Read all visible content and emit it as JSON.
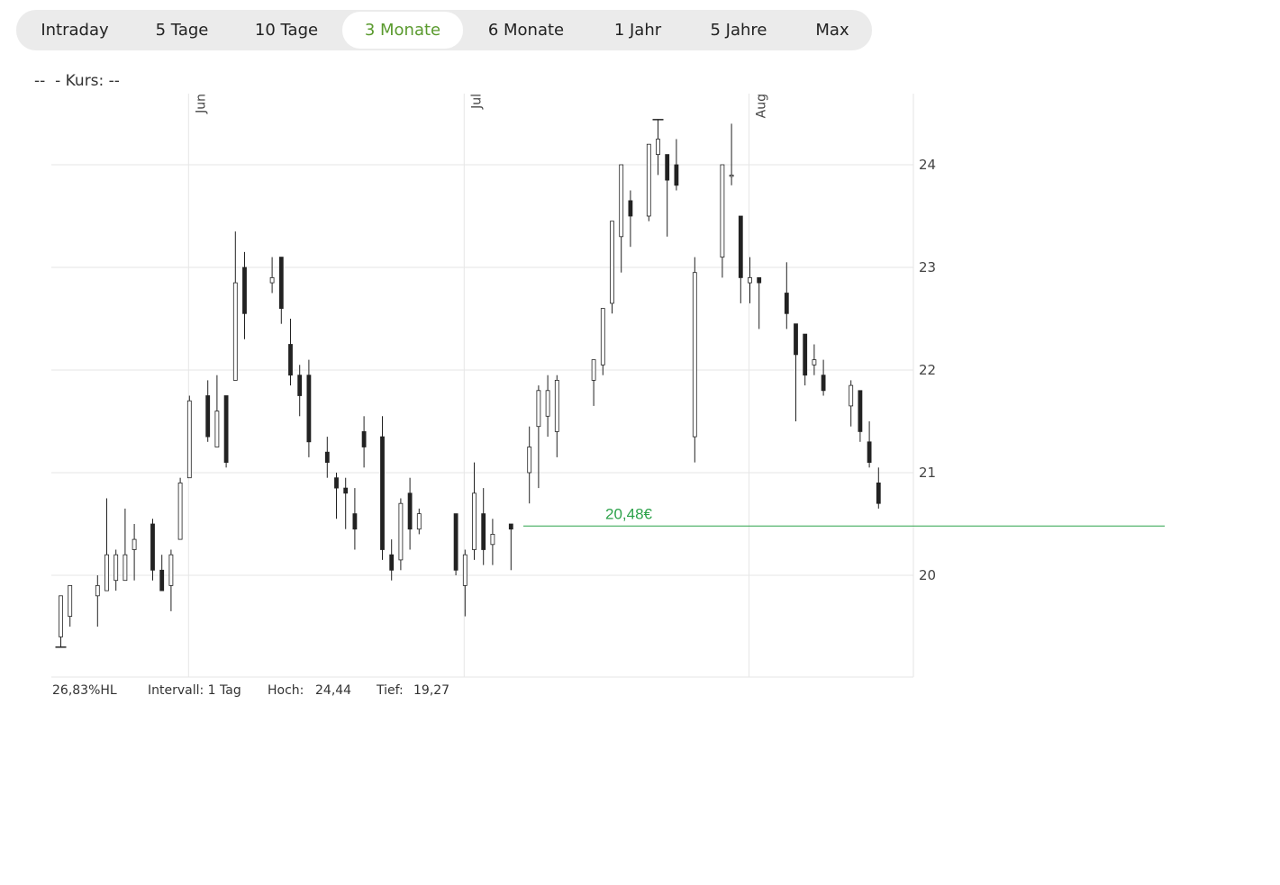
{
  "tabs": [
    {
      "label": "Intraday",
      "active": false
    },
    {
      "label": "5 Tage",
      "active": false
    },
    {
      "label": "10 Tage",
      "active": false
    },
    {
      "label": "3 Monate",
      "active": true
    },
    {
      "label": "6 Monate",
      "active": false
    },
    {
      "label": "1 Jahr",
      "active": false
    },
    {
      "label": "5 Jahre",
      "active": false
    },
    {
      "label": "Max",
      "active": false
    }
  ],
  "info_label": "--  - Kurs: --",
  "footer": {
    "hl": "26,83%HL",
    "interval": "Intervall: 1 Tag",
    "high_label": "Hoch:",
    "high_value": "24,44",
    "low_label": "Tief:",
    "low_value": "19,27"
  },
  "colors": {
    "accent": "#5a9a2e",
    "price_line": "#2ca24a",
    "candle": "#222222",
    "grid": "#e6e6e6"
  },
  "chart_data": {
    "type": "candlestick",
    "y_ticks": [
      20,
      21,
      22,
      23,
      24
    ],
    "ylim": [
      19.0,
      24.7
    ],
    "month_labels": [
      {
        "label": "Jun",
        "index": 14
      },
      {
        "label": "Jul",
        "index": 44
      },
      {
        "label": "Aug",
        "index": 75
      }
    ],
    "current_price": {
      "value": 20.48,
      "label": "20,48€"
    },
    "candles": [
      {
        "o": 19.4,
        "h": 19.8,
        "l": 19.3,
        "c": 19.8
      },
      {
        "o": 19.6,
        "h": 19.85,
        "l": 19.5,
        "c": 19.9
      },
      null,
      null,
      {
        "o": 19.8,
        "h": 20.0,
        "l": 19.5,
        "c": 19.9
      },
      {
        "o": 19.85,
        "h": 20.75,
        "l": 19.85,
        "c": 20.2
      },
      {
        "o": 19.95,
        "h": 20.25,
        "l": 19.85,
        "c": 20.2
      },
      {
        "o": 19.95,
        "h": 20.65,
        "l": 19.95,
        "c": 20.2
      },
      {
        "o": 20.25,
        "h": 20.5,
        "l": 19.95,
        "c": 20.35
      },
      null,
      {
        "o": 20.5,
        "h": 20.55,
        "l": 19.95,
        "c": 20.05
      },
      {
        "o": 20.05,
        "h": 20.2,
        "l": 19.85,
        "c": 19.85
      },
      {
        "o": 19.9,
        "h": 20.25,
        "l": 19.65,
        "c": 20.2
      },
      {
        "o": 20.35,
        "h": 20.95,
        "l": 20.35,
        "c": 20.9
      },
      {
        "o": 20.95,
        "h": 21.75,
        "l": 20.95,
        "c": 21.7
      },
      null,
      {
        "o": 21.75,
        "h": 21.9,
        "l": 21.3,
        "c": 21.35
      },
      {
        "o": 21.25,
        "h": 21.95,
        "l": 21.25,
        "c": 21.6
      },
      {
        "o": 21.75,
        "h": 21.75,
        "l": 21.05,
        "c": 21.1
      },
      {
        "o": 21.9,
        "h": 23.35,
        "l": 21.9,
        "c": 22.85
      },
      {
        "o": 23.0,
        "h": 23.15,
        "l": 22.3,
        "c": 22.55
      },
      null,
      null,
      {
        "o": 22.85,
        "h": 23.1,
        "l": 22.75,
        "c": 22.9
      },
      {
        "o": 23.1,
        "h": 23.1,
        "l": 22.45,
        "c": 22.6
      },
      {
        "o": 22.25,
        "h": 22.5,
        "l": 21.85,
        "c": 21.95
      },
      {
        "o": 21.95,
        "h": 22.05,
        "l": 21.55,
        "c": 21.75
      },
      {
        "o": 21.95,
        "h": 22.1,
        "l": 21.15,
        "c": 21.3
      },
      null,
      {
        "o": 21.2,
        "h": 21.35,
        "l": 20.95,
        "c": 21.1
      },
      {
        "o": 20.95,
        "h": 21.0,
        "l": 20.55,
        "c": 20.85
      },
      {
        "o": 20.85,
        "h": 20.95,
        "l": 20.45,
        "c": 20.8
      },
      {
        "o": 20.6,
        "h": 20.85,
        "l": 20.25,
        "c": 20.45
      },
      {
        "o": 21.4,
        "h": 21.55,
        "l": 21.05,
        "c": 21.25
      },
      null,
      {
        "o": 21.35,
        "h": 21.55,
        "l": 20.15,
        "c": 20.25
      },
      {
        "o": 20.2,
        "h": 20.35,
        "l": 19.95,
        "c": 20.05
      },
      {
        "o": 20.15,
        "h": 20.75,
        "l": 20.05,
        "c": 20.7
      },
      {
        "o": 20.8,
        "h": 20.95,
        "l": 20.25,
        "c": 20.45
      },
      {
        "o": 20.45,
        "h": 20.65,
        "l": 20.4,
        "c": 20.6
      },
      null,
      null,
      null,
      {
        "o": 20.6,
        "h": 20.6,
        "l": 20.0,
        "c": 20.05
      },
      {
        "o": 19.9,
        "h": 20.25,
        "l": 19.6,
        "c": 20.2
      },
      {
        "o": 20.25,
        "h": 21.1,
        "l": 20.15,
        "c": 20.8
      },
      {
        "o": 20.6,
        "h": 20.85,
        "l": 20.1,
        "c": 20.25
      },
      {
        "o": 20.3,
        "h": 20.55,
        "l": 20.1,
        "c": 20.4
      },
      null,
      {
        "o": 20.5,
        "h": 20.5,
        "l": 20.05,
        "c": 20.45
      },
      null,
      {
        "o": 21.0,
        "h": 21.45,
        "l": 20.7,
        "c": 21.25
      },
      {
        "o": 21.45,
        "h": 21.85,
        "l": 20.85,
        "c": 21.8
      },
      {
        "o": 21.55,
        "h": 21.95,
        "l": 21.35,
        "c": 21.8
      },
      {
        "o": 21.4,
        "h": 21.95,
        "l": 21.15,
        "c": 21.9
      },
      null,
      null,
      null,
      {
        "o": 21.9,
        "h": 22.05,
        "l": 21.65,
        "c": 22.1
      },
      {
        "o": 22.05,
        "h": 22.6,
        "l": 21.95,
        "c": 22.6
      },
      {
        "o": 22.65,
        "h": 23.45,
        "l": 22.55,
        "c": 23.45
      },
      {
        "o": 23.3,
        "h": 24.0,
        "l": 22.95,
        "c": 24.0
      },
      {
        "o": 23.65,
        "h": 23.75,
        "l": 23.2,
        "c": 23.5
      },
      null,
      {
        "o": 23.5,
        "h": 24.2,
        "l": 23.45,
        "c": 24.2
      },
      {
        "o": 24.1,
        "h": 24.44,
        "l": 23.9,
        "c": 24.25
      },
      {
        "o": 24.1,
        "h": 24.1,
        "l": 23.3,
        "c": 23.85
      },
      {
        "o": 24.0,
        "h": 24.25,
        "l": 23.75,
        "c": 23.8
      },
      null,
      {
        "o": 21.35,
        "h": 23.1,
        "l": 21.1,
        "c": 22.95
      },
      null,
      null,
      {
        "o": 23.1,
        "h": 24.0,
        "l": 22.9,
        "c": 24.0
      },
      {
        "o": 23.9,
        "h": 24.4,
        "l": 23.8,
        "c": 23.9
      },
      {
        "o": 23.5,
        "h": 23.5,
        "l": 22.65,
        "c": 22.9
      },
      {
        "o": 22.85,
        "h": 23.1,
        "l": 22.65,
        "c": 22.9
      },
      {
        "o": 22.9,
        "h": 22.9,
        "l": 22.4,
        "c": 22.85
      },
      null,
      null,
      {
        "o": 22.75,
        "h": 23.05,
        "l": 22.4,
        "c": 22.55
      },
      {
        "o": 22.45,
        "h": 22.45,
        "l": 21.5,
        "c": 22.15
      },
      {
        "o": 22.35,
        "h": 22.35,
        "l": 21.85,
        "c": 21.95
      },
      {
        "o": 22.05,
        "h": 22.25,
        "l": 21.95,
        "c": 22.1
      },
      {
        "o": 21.95,
        "h": 22.1,
        "l": 21.75,
        "c": 21.8
      },
      null,
      null,
      {
        "o": 21.65,
        "h": 21.9,
        "l": 21.45,
        "c": 21.85
      },
      {
        "o": 21.8,
        "h": 21.8,
        "l": 21.3,
        "c": 21.4
      },
      {
        "o": 21.3,
        "h": 21.5,
        "l": 21.05,
        "c": 21.1
      },
      {
        "o": 20.9,
        "h": 21.05,
        "l": 20.65,
        "c": 20.7
      }
    ]
  }
}
